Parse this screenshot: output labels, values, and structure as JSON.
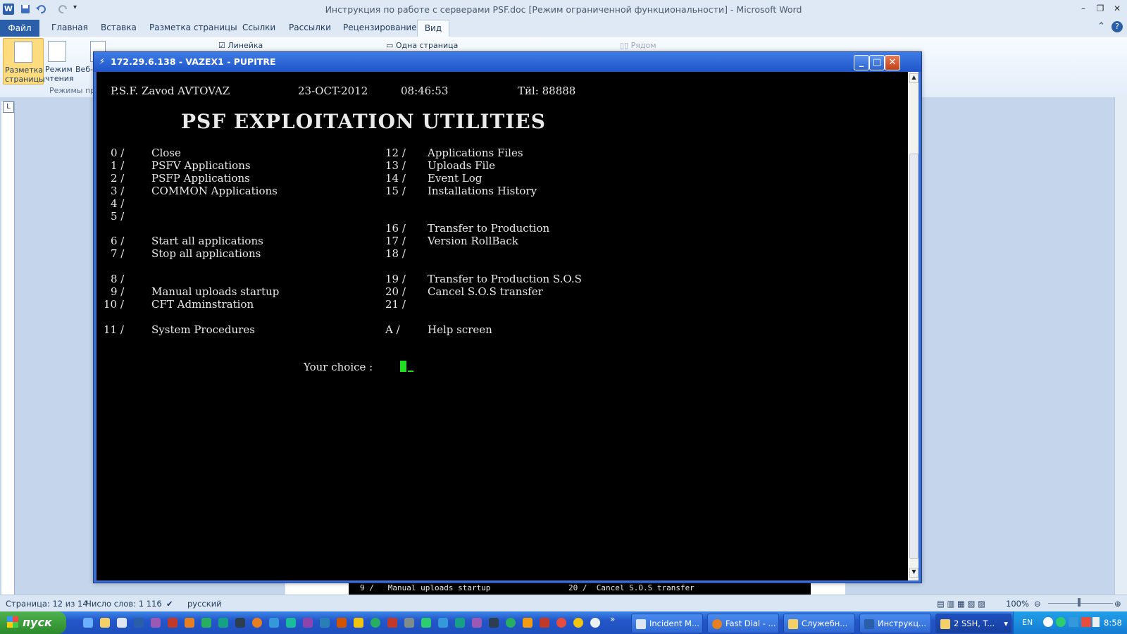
{
  "word": {
    "title": "Инструкция по работе с серверами PSF.doc [Режим ограниченной функциональности]  -  Microsoft Word",
    "tabs": [
      "Файл",
      "Главная",
      "Вставка",
      "Разметка страницы",
      "Ссылки",
      "Рассылки",
      "Рецензирование",
      "Вид"
    ],
    "ribbon": {
      "page_layout": "Разметка страницы",
      "read_mode": "Режим чтения",
      "web": "Веб-д",
      "group_label": "Режимы пр",
      "ruler_check": "Линейка",
      "one_page": "Одна страница",
      "side_by_side": "Рядом"
    },
    "ruler_corner": "L",
    "statusbar": {
      "page": "Страница: 12 из 14",
      "words": "Число слов: 1 116",
      "lang": "русский",
      "zoom": "100%"
    },
    "peek": {
      "left": "9 /   Manual uploads startup",
      "right": "20 /  Cancel S.O.S transfer"
    }
  },
  "terminal": {
    "title": "172.29.6.138 - VAZEX1 - PUPITRE",
    "header": {
      "company": "P.S.F. Zavod AVTOVAZ",
      "date": "23-OCT-2012",
      "time": "08:46:53",
      "tel": "Тйl: 88888"
    },
    "heading": "PSF EXPLOITATION UTILITIES",
    "left_menu": [
      {
        "num": "0 /",
        "label": "Close"
      },
      {
        "num": "1 /",
        "label": "PSFV Applications"
      },
      {
        "num": "2 /",
        "label": "PSFP Applications"
      },
      {
        "num": "3 /",
        "label": "COMMON Applications"
      },
      {
        "num": "4 /",
        "label": ""
      },
      {
        "num": "5 /",
        "label": ""
      },
      {
        "num": "6 /",
        "label": "Start all applications"
      },
      {
        "num": "7 /",
        "label": "Stop all applications"
      },
      {
        "num": "8 /",
        "label": ""
      },
      {
        "num": "9 /",
        "label": "Manual uploads startup"
      },
      {
        "num": "10 /",
        "label": "CFT Adminstration"
      },
      {
        "num": "11 /",
        "label": "System Procedures"
      }
    ],
    "right_menu": [
      {
        "num": "12 /",
        "label": "Applications Files"
      },
      {
        "num": "13 /",
        "label": "Uploads File"
      },
      {
        "num": "14 /",
        "label": "Event Log"
      },
      {
        "num": "15 /",
        "label": "Installations History"
      },
      {
        "num": "16 /",
        "label": "Transfer to Production"
      },
      {
        "num": "17 /",
        "label": "Version RollBack"
      },
      {
        "num": "18 /",
        "label": ""
      },
      {
        "num": "19 /",
        "label": "Transfer to Production S.O.S"
      },
      {
        "num": "20 /",
        "label": "Cancel S.O.S transfer"
      },
      {
        "num": "21 /",
        "label": ""
      },
      {
        "num": "A /",
        "label": "Help screen"
      }
    ],
    "prompt": "Your choice :"
  },
  "taskbar": {
    "start": "пуск",
    "tasks": [
      "Incident M...",
      "Fast Dial - ...",
      "Служебн...",
      "Инструкц...",
      "2 SSH, T..."
    ],
    "lang": "EN",
    "clock": "8:58"
  },
  "colors": {
    "accent": "#2a5ea8",
    "terminal_bg": "#000000",
    "terminal_text": "#eaeaea",
    "cursor": "#22dd22",
    "title_blue": "#1f55c8"
  }
}
